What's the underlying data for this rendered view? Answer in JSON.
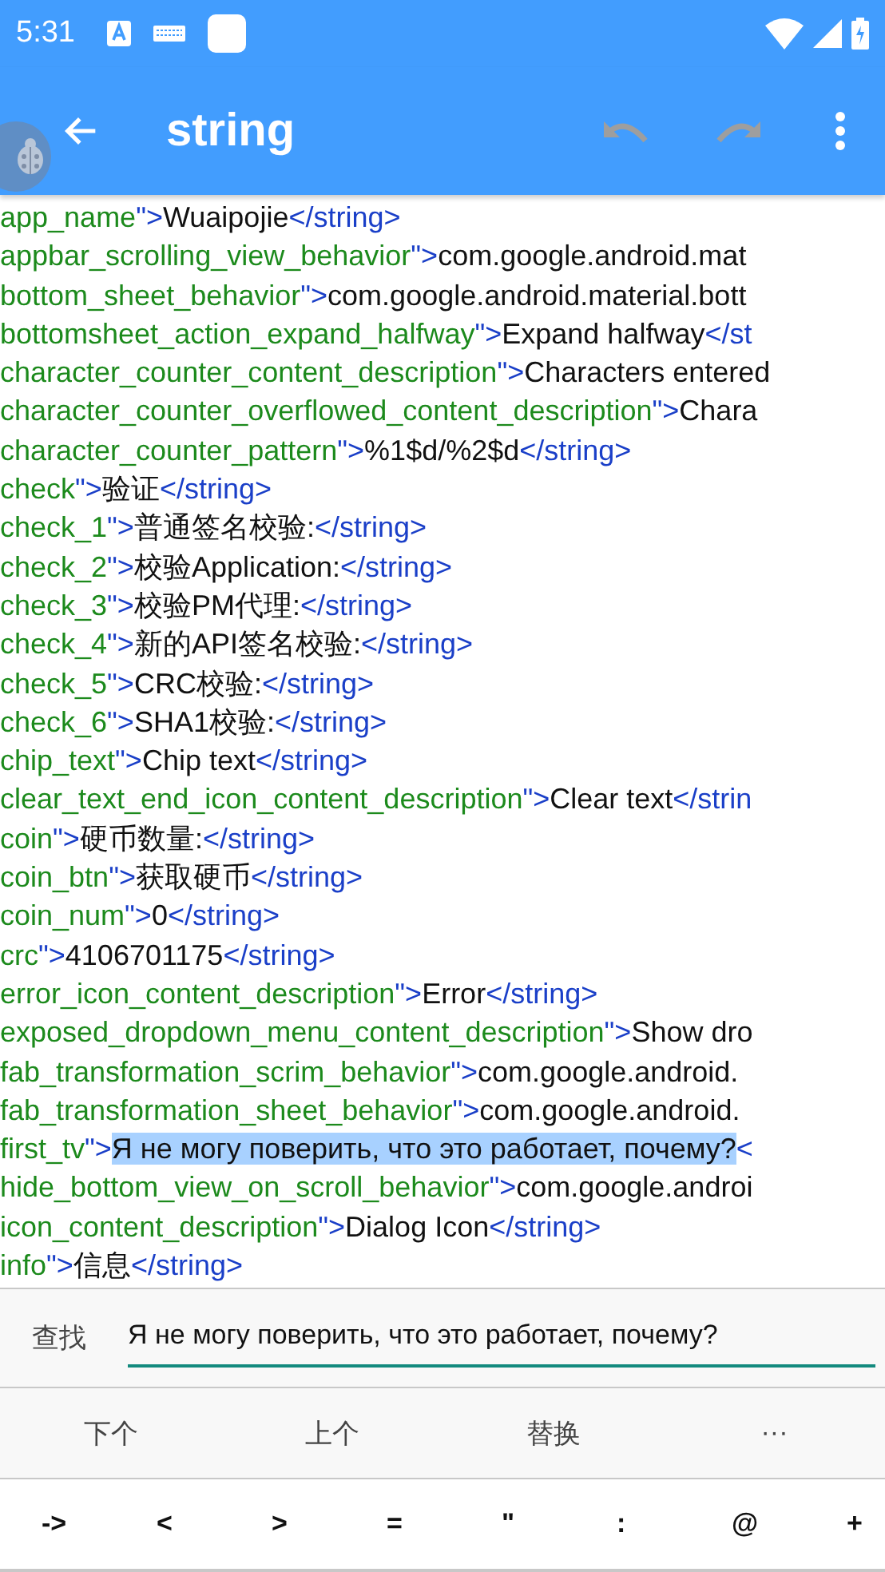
{
  "status_bar": {
    "time": "5:31"
  },
  "toolbar": {
    "title": "string",
    "undo": {
      "disabled": true
    },
    "redo": {
      "disabled": true
    }
  },
  "editor": {
    "lines": [
      {
        "key": "app_name",
        "sep": "\">",
        "value": "Wuaipojie",
        "close": "</string>",
        "selected": false
      },
      {
        "key": "appbar_scrolling_view_behavior",
        "sep": "\">",
        "value": "com.google.android.mat",
        "selected": false
      },
      {
        "key": "bottom_sheet_behavior",
        "sep": "\">",
        "value": "com.google.android.material.bott",
        "selected": false
      },
      {
        "key": "bottomsheet_action_expand_halfway",
        "sep": "\">",
        "value": "Expand halfway",
        "close": "</st",
        "selected": false
      },
      {
        "key": "character_counter_content_description",
        "sep": "\">",
        "value": "Characters entered",
        "selected": false
      },
      {
        "key": "character_counter_overflowed_content_description",
        "sep": "\">",
        "value": "Chara",
        "selected": false
      },
      {
        "key": "character_counter_pattern",
        "sep": "\">",
        "value": "%1$d/%2$d",
        "close": "</string>",
        "selected": false
      },
      {
        "key": "check",
        "sep": "\">",
        "value": "验证",
        "close": "</string>",
        "selected": false
      },
      {
        "key": "check_1",
        "sep": "\">",
        "value": "普通签名校验:",
        "close": "</string>",
        "selected": false
      },
      {
        "key": "check_2",
        "sep": "\">",
        "value": "校验Application:",
        "close": "</string>",
        "selected": false
      },
      {
        "key": "check_3",
        "sep": "\">",
        "value": "校验PM代理:",
        "close": "</string>",
        "selected": false
      },
      {
        "key": "check_4",
        "sep": "\">",
        "value": "新的API签名校验:",
        "close": "</string>",
        "selected": false
      },
      {
        "key": "check_5",
        "sep": "\">",
        "value": "CRC校验:",
        "close": "</string>",
        "selected": false
      },
      {
        "key": "check_6",
        "sep": "\">",
        "value": "SHA1校验:",
        "close": "</string>",
        "selected": false
      },
      {
        "key": "chip_text",
        "sep": "\">",
        "value": "Chip text",
        "close": "</string>",
        "selected": false
      },
      {
        "key": "clear_text_end_icon_content_description",
        "sep": "\">",
        "value": "Clear text",
        "close": "</strin",
        "selected": false
      },
      {
        "key": "coin",
        "sep": "\">",
        "value": "硬币数量:",
        "close": "</string>",
        "selected": false
      },
      {
        "key": "coin_btn",
        "sep": "\">",
        "value": "获取硬币",
        "close": "</string>",
        "selected": false
      },
      {
        "key": "coin_num",
        "sep": "\">",
        "value": "0",
        "close": "</string>",
        "selected": false
      },
      {
        "key": "crc",
        "sep": "\">",
        "value": "4106701175",
        "close": "</string>",
        "selected": false
      },
      {
        "key": "error_icon_content_description",
        "sep": "\">",
        "value": "Error",
        "close": "</string>",
        "selected": false
      },
      {
        "key": "exposed_dropdown_menu_content_description",
        "sep": "\">",
        "value": "Show dro",
        "selected": false
      },
      {
        "key": "fab_transformation_scrim_behavior",
        "sep": "\">",
        "value": "com.google.android.",
        "selected": false
      },
      {
        "key": "fab_transformation_sheet_behavior",
        "sep": "\">",
        "value": "com.google.android.",
        "selected": false
      },
      {
        "key": "first_tv",
        "sep": "\">",
        "value": "Я не могу поверить, что это работает, почему?",
        "close": "<",
        "selected": true
      },
      {
        "key": "hide_bottom_view_on_scroll_behavior",
        "sep": "\">",
        "value": "com.google.androi",
        "selected": false
      },
      {
        "key": "icon_content_description",
        "sep": "\">",
        "value": "Dialog Icon",
        "close": "</string>",
        "selected": false
      },
      {
        "key": "info",
        "sep": "\">",
        "value": "信息",
        "close": "</string>",
        "selected": false
      }
    ]
  },
  "find_bar": {
    "label": "查找",
    "value": "Я не могу поверить, что это работает, почему?"
  },
  "actions": [
    {
      "label": "下个"
    },
    {
      "label": "上个"
    },
    {
      "label": "替换"
    },
    {
      "label": "···"
    }
  ],
  "symbols": [
    "->",
    "<",
    ">",
    "=",
    "\"",
    ":",
    "@",
    "+"
  ]
}
